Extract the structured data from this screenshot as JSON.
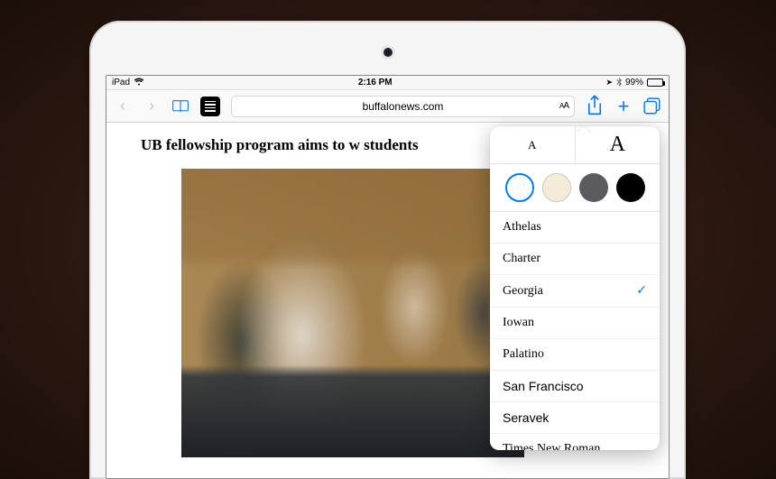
{
  "statusBar": {
    "carrier": "iPad",
    "time": "2:16 PM",
    "batteryPct": "99%"
  },
  "toolbar": {
    "url": "buffalonews.com",
    "readerSizeGlyph": "A"
  },
  "article": {
    "headline": "UB fellowship program aims to w                                     students"
  },
  "readerPopover": {
    "sizeSmallLabel": "A",
    "sizeLargeLabel": "A",
    "themes": [
      "white",
      "sepia",
      "gray",
      "black"
    ],
    "selectedTheme": "white",
    "fonts": [
      {
        "name": "Athelas",
        "cls": "athelas",
        "selected": false
      },
      {
        "name": "Charter",
        "cls": "charter",
        "selected": false
      },
      {
        "name": "Georgia",
        "cls": "georgia",
        "selected": true
      },
      {
        "name": "Iowan",
        "cls": "iowan",
        "selected": false
      },
      {
        "name": "Palatino",
        "cls": "palatino",
        "selected": false
      },
      {
        "name": "San Francisco",
        "cls": "sf",
        "selected": false
      },
      {
        "name": "Seravek",
        "cls": "seravek",
        "selected": false
      },
      {
        "name": "Times New Roman",
        "cls": "tnr",
        "selected": false
      }
    ]
  }
}
